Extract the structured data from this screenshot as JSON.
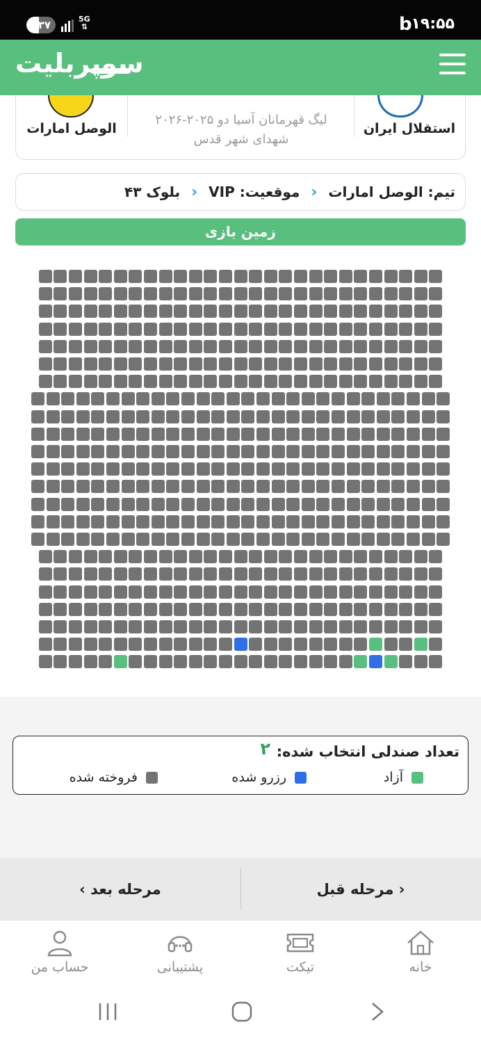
{
  "status_bar": {
    "time": "۱۹:۵۵",
    "battery": "۳۷",
    "network": "5G"
  },
  "header": {
    "logo_text": "سوپربلیت",
    "menu_icon": "hamburger-icon"
  },
  "match": {
    "home_team": "استقلال ایران",
    "away_team": "الوصل امارات",
    "competition": "لیگ قهرمانان آسیا دو ۲۰۲۵-۲۰۲۶",
    "stadium": "شهدای شهر قدس"
  },
  "breadcrumb": {
    "team": "تیم: الوصل امارات",
    "position": "موقعیت: VIP",
    "block": "بلوک ۴۳"
  },
  "field_label": "زمین بازی",
  "seat_status_legend": {
    "count_label": "تعداد صندلی انتخاب شده:",
    "count_value": "۲",
    "free": "آزاد",
    "reserved": "رزرو شده",
    "sold": "فروخته شده"
  },
  "colors": {
    "accent": "#59bf7e",
    "sold": "#737373",
    "reserved": "#2e6fe8",
    "free": "#59bf7e",
    "breadcrumb_chevron": "#25a3e0"
  },
  "seat_map": {
    "rows": [
      {
        "seats": [
          "s",
          "s",
          "s",
          "s",
          "s",
          "s",
          "s",
          "s",
          "s",
          "s",
          "s",
          "s",
          "s",
          "s",
          "s",
          "s",
          "s",
          "s",
          "s",
          "s",
          "s",
          "s",
          "s",
          "s",
          "s",
          "s",
          "s"
        ]
      },
      {
        "seats": [
          "s",
          "s",
          "s",
          "s",
          "s",
          "s",
          "s",
          "s",
          "s",
          "s",
          "s",
          "s",
          "s",
          "s",
          "s",
          "s",
          "s",
          "s",
          "s",
          "s",
          "s",
          "s",
          "s",
          "s",
          "s",
          "s",
          "s"
        ]
      },
      {
        "seats": [
          "s",
          "s",
          "s",
          "s",
          "s",
          "s",
          "s",
          "s",
          "s",
          "s",
          "s",
          "s",
          "s",
          "s",
          "s",
          "s",
          "s",
          "s",
          "s",
          "s",
          "s",
          "s",
          "s",
          "s",
          "s",
          "s",
          "s"
        ]
      },
      {
        "seats": [
          "s",
          "s",
          "s",
          "s",
          "s",
          "s",
          "s",
          "s",
          "s",
          "s",
          "s",
          "s",
          "s",
          "s",
          "s",
          "s",
          "s",
          "s",
          "s",
          "s",
          "s",
          "s",
          "s",
          "s",
          "s",
          "s",
          "s"
        ]
      },
      {
        "seats": [
          "s",
          "s",
          "s",
          "s",
          "s",
          "s",
          "s",
          "s",
          "s",
          "s",
          "s",
          "s",
          "s",
          "s",
          "s",
          "s",
          "s",
          "s",
          "s",
          "s",
          "s",
          "s",
          "s",
          "s",
          "s",
          "s",
          "s"
        ]
      },
      {
        "seats": [
          "s",
          "s",
          "s",
          "s",
          "s",
          "s",
          "s",
          "s",
          "s",
          "s",
          "s",
          "s",
          "s",
          "s",
          "s",
          "s",
          "s",
          "s",
          "s",
          "s",
          "s",
          "s",
          "s",
          "s",
          "s",
          "s",
          "s"
        ]
      },
      {
        "seats": [
          "s",
          "s",
          "s",
          "s",
          "s",
          "s",
          "s",
          "s",
          "s",
          "s",
          "s",
          "s",
          "s",
          "s",
          "s",
          "s",
          "s",
          "s",
          "s",
          "s",
          "s",
          "s",
          "s",
          "s",
          "s",
          "s",
          "s"
        ]
      },
      {
        "seats": [
          "s",
          "s",
          "s",
          "s",
          "s",
          "s",
          "s",
          "s",
          "s",
          "s",
          "s",
          "s",
          "s",
          "s",
          "s",
          "s",
          "s",
          "s",
          "s",
          "s",
          "s",
          "s",
          "s",
          "s",
          "s",
          "s",
          "s",
          "s"
        ]
      },
      {
        "seats": [
          "s",
          "s",
          "s",
          "s",
          "s",
          "s",
          "s",
          "s",
          "s",
          "s",
          "s",
          "s",
          "s",
          "s",
          "s",
          "s",
          "s",
          "s",
          "s",
          "s",
          "s",
          "s",
          "s",
          "s",
          "s",
          "s",
          "s",
          "s"
        ]
      },
      {
        "seats": [
          "s",
          "s",
          "s",
          "s",
          "s",
          "s",
          "s",
          "s",
          "s",
          "s",
          "s",
          "s",
          "s",
          "s",
          "s",
          "s",
          "s",
          "s",
          "s",
          "s",
          "s",
          "s",
          "s",
          "s",
          "s",
          "s",
          "s",
          "s"
        ]
      },
      {
        "seats": [
          "s",
          "s",
          "s",
          "s",
          "s",
          "s",
          "s",
          "s",
          "s",
          "s",
          "s",
          "s",
          "s",
          "s",
          "s",
          "s",
          "s",
          "s",
          "s",
          "s",
          "s",
          "s",
          "s",
          "s",
          "s",
          "s",
          "s",
          "s"
        ]
      },
      {
        "seats": [
          "s",
          "s",
          "s",
          "s",
          "s",
          "s",
          "s",
          "s",
          "s",
          "s",
          "s",
          "s",
          "s",
          "s",
          "s",
          "s",
          "s",
          "s",
          "s",
          "s",
          "s",
          "s",
          "s",
          "s",
          "s",
          "s",
          "s",
          "s"
        ]
      },
      {
        "seats": [
          "s",
          "s",
          "s",
          "s",
          "s",
          "s",
          "s",
          "s",
          "s",
          "s",
          "s",
          "s",
          "s",
          "s",
          "s",
          "s",
          "s",
          "s",
          "s",
          "s",
          "s",
          "s",
          "s",
          "s",
          "s",
          "s",
          "s",
          "s"
        ]
      },
      {
        "seats": [
          "s",
          "s",
          "s",
          "s",
          "s",
          "s",
          "s",
          "s",
          "s",
          "s",
          "s",
          "s",
          "s",
          "s",
          "s",
          "s",
          "s",
          "s",
          "s",
          "s",
          "s",
          "s",
          "s",
          "s",
          "s",
          "s",
          "s",
          "s"
        ]
      },
      {
        "seats": [
          "s",
          "s",
          "s",
          "s",
          "s",
          "s",
          "s",
          "s",
          "s",
          "s",
          "s",
          "s",
          "s",
          "s",
          "s",
          "s",
          "s",
          "s",
          "s",
          "s",
          "s",
          "s",
          "s",
          "s",
          "s",
          "s",
          "s",
          "s"
        ]
      },
      {
        "seats": [
          "s",
          "s",
          "s",
          "s",
          "s",
          "s",
          "s",
          "s",
          "s",
          "s",
          "s",
          "s",
          "s",
          "s",
          "s",
          "s",
          "s",
          "s",
          "s",
          "s",
          "s",
          "s",
          "s",
          "s",
          "s",
          "s",
          "s",
          "s"
        ]
      },
      {
        "seats": [
          "s",
          "s",
          "s",
          "s",
          "s",
          "s",
          "s",
          "s",
          "s",
          "s",
          "s",
          "s",
          "s",
          "s",
          "s",
          "s",
          "s",
          "s",
          "s",
          "s",
          "s",
          "s",
          "s",
          "s",
          "s",
          "s",
          "s"
        ]
      },
      {
        "seats": [
          "s",
          "s",
          "s",
          "s",
          "s",
          "s",
          "s",
          "s",
          "s",
          "s",
          "s",
          "s",
          "s",
          "s",
          "s",
          "s",
          "s",
          "s",
          "s",
          "s",
          "s",
          "s",
          "s",
          "s",
          "s",
          "s",
          "s"
        ]
      },
      {
        "seats": [
          "s",
          "s",
          "s",
          "s",
          "s",
          "s",
          "s",
          "s",
          "s",
          "s",
          "s",
          "s",
          "s",
          "s",
          "s",
          "s",
          "s",
          "s",
          "s",
          "s",
          "s",
          "s",
          "s",
          "s",
          "s",
          "s",
          "s"
        ]
      },
      {
        "seats": [
          "s",
          "s",
          "s",
          "s",
          "s",
          "s",
          "s",
          "s",
          "s",
          "s",
          "s",
          "s",
          "s",
          "s",
          "s",
          "s",
          "s",
          "s",
          "s",
          "s",
          "s",
          "s",
          "s",
          "s",
          "s",
          "s",
          "s"
        ]
      },
      {
        "seats": [
          "s",
          "s",
          "s",
          "s",
          "s",
          "s",
          "s",
          "s",
          "s",
          "s",
          "s",
          "s",
          "s",
          "s",
          "s",
          "s",
          "s",
          "s",
          "s",
          "s",
          "s",
          "s",
          "s",
          "s",
          "s",
          "s",
          "s"
        ]
      },
      {
        "seats": [
          "s",
          "s",
          "s",
          "s",
          "s",
          "s",
          "s",
          "s",
          "s",
          "s",
          "s",
          "s",
          "s",
          "r",
          "s",
          "s",
          "s",
          "s",
          "s",
          "s",
          "s",
          "s",
          "f",
          "s",
          "s",
          "f",
          "s"
        ]
      },
      {
        "seats": [
          "s",
          "s",
          "s",
          "s",
          "s",
          "f",
          "s",
          "s",
          "s",
          "s",
          "s",
          "s",
          "s",
          "s",
          "s",
          "s",
          "s",
          "s",
          "s",
          "s",
          "s",
          "f",
          "r",
          "f",
          "s",
          "s",
          "s"
        ]
      }
    ]
  },
  "steps": {
    "prev": "مرحله قبل",
    "next": "مرحله بعد"
  },
  "bottom_nav": {
    "home": "خانه",
    "ticket": "تیکت",
    "support": "پشتیبانی",
    "account": "حساب من"
  }
}
